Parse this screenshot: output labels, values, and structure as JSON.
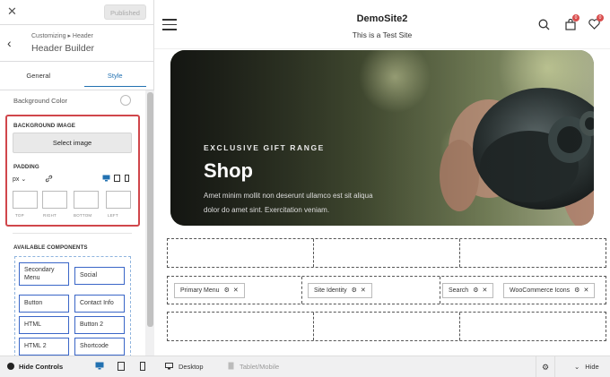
{
  "panel": {
    "close_glyph": "✕",
    "published_label": "Published",
    "back_glyph": "‹",
    "breadcrumb": "Customizing ▸ Header",
    "title": "Header Builder",
    "tabs": [
      {
        "label": "General"
      },
      {
        "label": "Style"
      }
    ],
    "background_color_label": "Background Color",
    "background_image_label": "BACKGROUND IMAGE",
    "select_image_label": "Select image",
    "padding_label": "PADDING",
    "padding_unit": "px ⌄",
    "padding_sides": [
      "TOP",
      "RIGHT",
      "BOTTOM",
      "LEFT"
    ],
    "padding_values": [
      "",
      "",
      "",
      ""
    ],
    "available_components_label": "AVAILABLE COMPONENTS",
    "components": [
      {
        "label": "Secondary Menu"
      },
      {
        "label": "Social"
      },
      {
        "label": "Button"
      },
      {
        "label": "Contact Info"
      },
      {
        "label": "HTML"
      },
      {
        "label": "Button 2"
      },
      {
        "label": "HTML 2"
      },
      {
        "label": "Shortcode"
      }
    ]
  },
  "bottombar": {
    "hide_controls_label": "Hide Controls",
    "desktop_label": "Desktop",
    "tablet_label": "Tablet/Mobile",
    "hide_label": "Hide"
  },
  "preview": {
    "site_title": "DemoSite2",
    "site_tagline": "This is a Test Site",
    "cart_count": "0",
    "wishlist_count": "0",
    "hero": {
      "subtitle": "EXCLUSIVE GIFT RANGE",
      "title": "Shop",
      "text_line1": "Amet minim mollit non deserunt ullamco est sit aliqua",
      "text_line2": "dolor do amet sint. Exercitation veniam."
    },
    "builder": {
      "main_row": [
        {
          "label": "Primary Menu"
        },
        {
          "label": "Site Identity"
        },
        {
          "label": "Search"
        },
        {
          "label": "WooCommerce Icons"
        }
      ]
    }
  },
  "colors": {
    "accent": "#2271b1",
    "highlight": "#d0464b",
    "component_border": "#3a66c7",
    "badge": "#d94d4d"
  }
}
